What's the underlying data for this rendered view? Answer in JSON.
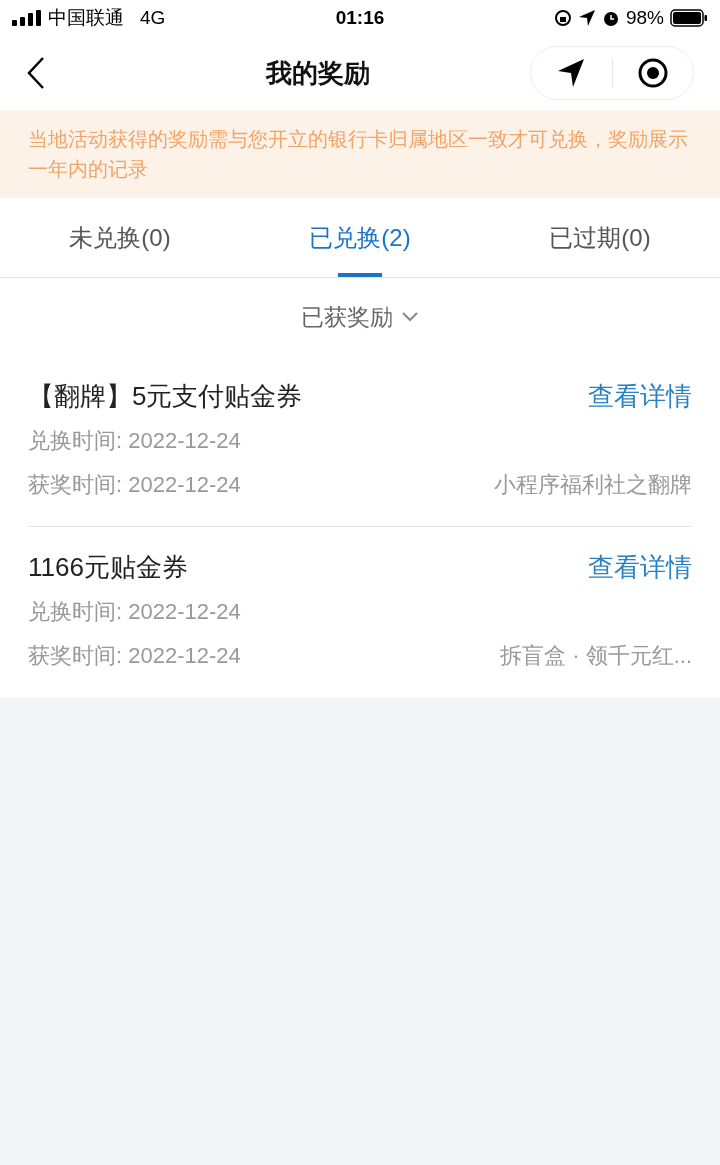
{
  "status_bar": {
    "carrier": "中国联通",
    "network": "4G",
    "time": "01:16",
    "battery": "98%"
  },
  "header": {
    "title": "我的奖励"
  },
  "notice": "当地活动获得的奖励需与您开立的银行卡归属地区一致才可兑换，奖励展示一年内的记录",
  "tabs": [
    {
      "label": "未兑换(0)",
      "selected": false
    },
    {
      "label": "已兑换(2)",
      "selected": true
    },
    {
      "label": "已过期(0)",
      "selected": false
    }
  ],
  "filter": {
    "label": "已获奖励"
  },
  "rewards": [
    {
      "title": "【翻牌】5元支付贴金券",
      "link": "查看详情",
      "exchange_time": "兑换时间: 2022-12-24",
      "award_time": "获奖时间: 2022-12-24",
      "source": "小程序福利社之翻牌"
    },
    {
      "title": "1166元贴金券",
      "link": "查看详情",
      "exchange_time": "兑换时间: 2022-12-24",
      "award_time": "获奖时间: 2022-12-24",
      "source": "拆盲盒 · 领千元红..."
    }
  ]
}
